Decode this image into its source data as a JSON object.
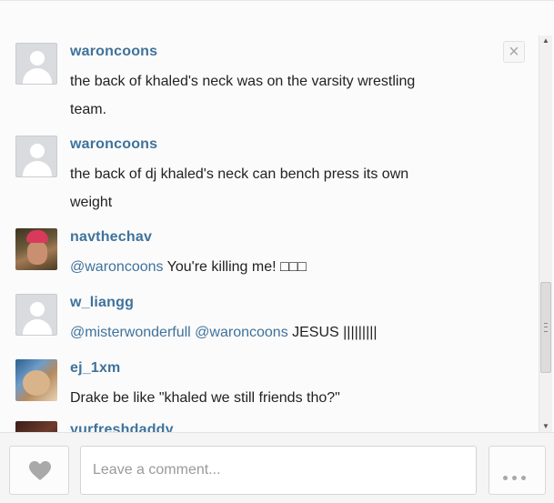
{
  "comments": [
    {
      "username": "waroncoons",
      "avatar": "default-user-icon",
      "text_lines": [
        "the back of khaled's neck was on the varsity wrestling",
        "team."
      ]
    },
    {
      "username": "waroncoons",
      "avatar": "default-user-icon",
      "text_lines": [
        "the back of dj khaled's neck can bench press its own",
        "weight"
      ]
    },
    {
      "username": "navthechav",
      "avatar": "user-photo",
      "mention": "@waroncoons",
      "text": " You're killing me! □□□"
    },
    {
      "username": "w_liangg",
      "avatar": "default-user-icon",
      "mention": "@misterwonderfull @waroncoons",
      "text": " JESUS |||||||||"
    },
    {
      "username": "ej_1xm",
      "avatar": "user-photo",
      "text": "Drake be like \"khaled we still friends tho?\""
    },
    {
      "username": "yurfreshdaddy",
      "avatar": "user-photo"
    }
  ],
  "close_icon": "×",
  "composer": {
    "placeholder": "Leave a comment...",
    "like_icon": "heart-icon",
    "more_icon": "ellipsis-icon"
  },
  "colors": {
    "username": "#3f729b",
    "text": "#222222",
    "background": "#fbfbfb"
  }
}
